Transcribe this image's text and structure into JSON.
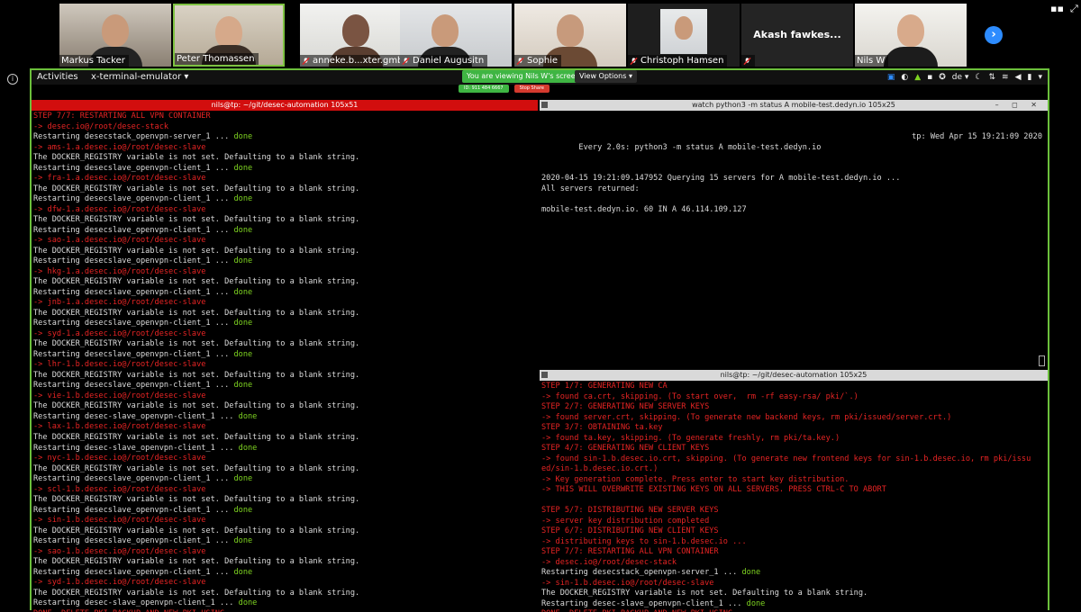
{
  "participants": [
    {
      "name": "Markus Tacker",
      "muted": false
    },
    {
      "name": "Peter Thomassen",
      "muted": false,
      "active": true
    },
    {
      "name": "anneke.b...xter.gmbh",
      "muted": true
    },
    {
      "name": "Daniel Augusitn",
      "muted": true
    },
    {
      "name": "Sophie",
      "muted": true
    },
    {
      "name": "Christoph Hamsen",
      "muted": true
    },
    {
      "name": "",
      "muted": true,
      "big_name": "Akash fawkes..."
    },
    {
      "name": "Nils W",
      "muted": false
    }
  ],
  "top_bar": {
    "activities": "Activities",
    "app_menu": "x-terminal-emulator ▾",
    "viewing_label": "You are viewing Nils W's screen",
    "view_options": "View Options ▾",
    "lang": "de ▾"
  },
  "meeting": {
    "id_label": "ID: 911 484 6667",
    "stop_label": "Stop Share"
  },
  "left_terminal": {
    "title": "nils@tp: ~/git/desec-automation 105x51",
    "lines": [
      {
        "t": "STEP 7/7: RESTARTING ALL VPN CONTAINER",
        "c": "red"
      },
      {
        "t": "-> desec.io@/root/desec-stack",
        "c": "red"
      },
      {
        "t": "Restarting desecstack_openvpn-server_1 ... ",
        "c": "white",
        "ok": "done"
      },
      {
        "t": "-> ams-1.a.desec.io@/root/desec-slave",
        "c": "red"
      },
      {
        "t": "The DOCKER_REGISTRY variable is not set. Defaulting to a blank string.",
        "c": "white"
      },
      {
        "t": "Restarting desecslave_openvpn-client_1 ... ",
        "c": "white",
        "ok": "done"
      },
      {
        "t": "-> fra-1.a.desec.io@/root/desec-slave",
        "c": "red"
      },
      {
        "t": "The DOCKER_REGISTRY variable is not set. Defaulting to a blank string.",
        "c": "white"
      },
      {
        "t": "Restarting desecslave_openvpn-client_1 ... ",
        "c": "white",
        "ok": "done"
      },
      {
        "t": "-> dfw-1.a.desec.io@/root/desec-slave",
        "c": "red"
      },
      {
        "t": "The DOCKER_REGISTRY variable is not set. Defaulting to a blank string.",
        "c": "white"
      },
      {
        "t": "Restarting desecslave_openvpn-client_1 ... ",
        "c": "white",
        "ok": "done"
      },
      {
        "t": "-> sao-1.a.desec.io@/root/desec-slave",
        "c": "red"
      },
      {
        "t": "The DOCKER_REGISTRY variable is not set. Defaulting to a blank string.",
        "c": "white"
      },
      {
        "t": "Restarting desecslave_openvpn-client_1 ... ",
        "c": "white",
        "ok": "done"
      },
      {
        "t": "-> hkg-1.a.desec.io@/root/desec-slave",
        "c": "red"
      },
      {
        "t": "The DOCKER_REGISTRY variable is not set. Defaulting to a blank string.",
        "c": "white"
      },
      {
        "t": "Restarting desecslave_openvpn-client_1 ... ",
        "c": "white",
        "ok": "done"
      },
      {
        "t": "-> jnb-1.a.desec.io@/root/desec-slave",
        "c": "red"
      },
      {
        "t": "The DOCKER_REGISTRY variable is not set. Defaulting to a blank string.",
        "c": "white"
      },
      {
        "t": "Restarting desecslave_openvpn-client_1 ... ",
        "c": "white",
        "ok": "done"
      },
      {
        "t": "-> syd-1.a.desec.io@/root/desec-slave",
        "c": "red"
      },
      {
        "t": "The DOCKER_REGISTRY variable is not set. Defaulting to a blank string.",
        "c": "white"
      },
      {
        "t": "Restarting desecslave_openvpn-client_1 ... ",
        "c": "white",
        "ok": "done"
      },
      {
        "t": "-> lhr-1.b.desec.io@/root/desec-slave",
        "c": "red"
      },
      {
        "t": "The DOCKER_REGISTRY variable is not set. Defaulting to a blank string.",
        "c": "white"
      },
      {
        "t": "Restarting desecslave_openvpn-client_1 ... ",
        "c": "white",
        "ok": "done"
      },
      {
        "t": "-> vie-1.b.desec.io@/root/desec-slave",
        "c": "red"
      },
      {
        "t": "The DOCKER_REGISTRY variable is not set. Defaulting to a blank string.",
        "c": "white"
      },
      {
        "t": "Restarting desec-slave_openvpn-client_1 ... ",
        "c": "white",
        "ok": "done"
      },
      {
        "t": "-> lax-1.b.desec.io@/root/desec-slave",
        "c": "red"
      },
      {
        "t": "The DOCKER_REGISTRY variable is not set. Defaulting to a blank string.",
        "c": "white"
      },
      {
        "t": "Restarting desec-slave_openvpn-client_1 ... ",
        "c": "white",
        "ok": "done"
      },
      {
        "t": "-> nyc-1.b.desec.io@/root/desec-slave",
        "c": "red"
      },
      {
        "t": "The DOCKER_REGISTRY variable is not set. Defaulting to a blank string.",
        "c": "white"
      },
      {
        "t": "Restarting desecslave_openvpn-client_1 ... ",
        "c": "white",
        "ok": "done"
      },
      {
        "t": "-> scl-1.b.desec.io@/root/desec-slave",
        "c": "red"
      },
      {
        "t": "The DOCKER_REGISTRY variable is not set. Defaulting to a blank string.",
        "c": "white"
      },
      {
        "t": "Restarting desecslave_openvpn-client_1 ... ",
        "c": "white",
        "ok": "done"
      },
      {
        "t": "-> sin-1.b.desec.io@/root/desec-slave",
        "c": "red"
      },
      {
        "t": "The DOCKER_REGISTRY variable is not set. Defaulting to a blank string.",
        "c": "white"
      },
      {
        "t": "Restarting desecslave_openvpn-client_1 ... ",
        "c": "white",
        "ok": "done"
      },
      {
        "t": "-> sao-1.b.desec.io@/root/desec-slave",
        "c": "red"
      },
      {
        "t": "The DOCKER_REGISTRY variable is not set. Defaulting to a blank string.",
        "c": "white"
      },
      {
        "t": "Restarting desecslave_openvpn-client_1 ... ",
        "c": "white",
        "ok": "done"
      },
      {
        "t": "-> syd-1.b.desec.io@/root/desec-slave",
        "c": "red"
      },
      {
        "t": "The DOCKER_REGISTRY variable is not set. Defaulting to a blank string.",
        "c": "white"
      },
      {
        "t": "Restarting desec-slave_openvpn-client_1 ... ",
        "c": "white",
        "ok": "done"
      },
      {
        "t": "DONE. DELETE PKI BACKUP AND NEW PKI USING",
        "c": "red"
      }
    ]
  },
  "watch_terminal": {
    "title": "watch python3 -m status A mobile-test.dedyn.io 105x25",
    "header": "Every 2.0s: python3 -m status A mobile-test.dedyn.io",
    "clock": "tp: Wed Apr 15 19:21:09 2020",
    "lines": [
      "",
      "2020-04-15 19:21:09.147952 Querying 15 servers for A mobile-test.dedyn.io ...",
      "All servers returned:",
      "",
      "mobile-test.dedyn.io. 60 IN A 46.114.109.127"
    ]
  },
  "lower_terminal": {
    "title": "nils@tp: ~/git/desec-automation 105x25",
    "lines": [
      {
        "t": "STEP 1/7: GENERATING NEW CA",
        "c": "red"
      },
      {
        "t": "-> found ca.crt, skipping. (To start over,  rm -rf easy-rsa/ pki/`.)",
        "c": "red"
      },
      {
        "t": "STEP 2/7: GENERATING NEW SERVER KEYS",
        "c": "red"
      },
      {
        "t": "-> found server.crt, skipping. (To generate new backend keys, rm pki/issued/server.crt.)",
        "c": "red"
      },
      {
        "t": "STEP 3/7: OBTAINING ta.key",
        "c": "red"
      },
      {
        "t": "-> found ta.key, skipping. (To generate freshly, rm pki/ta.key.)",
        "c": "red"
      },
      {
        "t": "STEP 4/7: GENERATING NEW CLIENT KEYS",
        "c": "red"
      },
      {
        "t": "-> found sin-1.b.desec.io.crt, skipping. (To generate new frontend keys for sin-1.b.desec.io, rm pki/issu",
        "c": "red"
      },
      {
        "t": "ed/sin-1.b.desec.io.crt.)",
        "c": "red"
      },
      {
        "t": "-> Key generation complete. Press enter to start key distribution.",
        "c": "red"
      },
      {
        "t": "-> THIS WILL OVERWRITE EXISTING KEYS ON ALL SERVERS. PRESS CTRL-C TO ABORT",
        "c": "red"
      },
      {
        "t": "",
        "c": "white"
      },
      {
        "t": "STEP 5/7: DISTRIBUTING NEW SERVER KEYS",
        "c": "red"
      },
      {
        "t": "-> server key distribution completed",
        "c": "red"
      },
      {
        "t": "STEP 6/7: DISTRIBUTING NEW CLIENT KEYS",
        "c": "red"
      },
      {
        "t": "-> distributing keys to sin-1.b.desec.io ...",
        "c": "red"
      },
      {
        "t": "STEP 7/7: RESTARTING ALL VPN CONTAINER",
        "c": "red"
      },
      {
        "t": "-> desec.io@/root/desec-stack",
        "c": "red"
      },
      {
        "t": "Restarting desecstack_openvpn-server_1 ... ",
        "c": "white",
        "ok": "done"
      },
      {
        "t": "-> sin-1.b.desec.io@/root/desec-slave",
        "c": "red"
      },
      {
        "t": "The DOCKER_REGISTRY variable is not set. Defaulting to a blank string.",
        "c": "white"
      },
      {
        "t": "Restarting desec-slave_openvpn-client_1 ... ",
        "c": "white",
        "ok": "done"
      },
      {
        "t": "DONE. DELETE PKI BACKUP AND NEW PKI USING",
        "c": "red"
      }
    ]
  },
  "colors": {
    "accent_green": "#6bbf3b",
    "zoom_blue": "#2d8cff",
    "term_red": "#e82424",
    "term_done": "#7ed321"
  }
}
